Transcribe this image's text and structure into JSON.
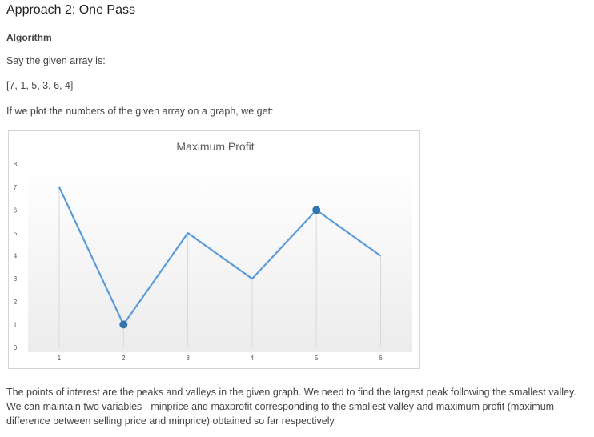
{
  "heading": "Approach 2: One Pass",
  "subheading": "Algorithm",
  "intro": "Say the given array is:",
  "array_text": "[7, 1, 5, 3, 6, 4]",
  "plot_text": "If we plot the numbers of the given array on a graph, we get:",
  "chart_data": {
    "type": "line",
    "title": "Maximum Profit",
    "x": [
      1,
      2,
      3,
      4,
      5,
      6
    ],
    "y": [
      7,
      1,
      5,
      3,
      6,
      4
    ],
    "xlabel": "",
    "ylabel": "",
    "ylim": [
      0,
      8
    ],
    "yticks": [
      0,
      1,
      2,
      3,
      4,
      5,
      6,
      7,
      8
    ],
    "grid": "vertical drop lines at each x",
    "highlighted_points": [
      {
        "x": 2,
        "y": 1
      },
      {
        "x": 5,
        "y": 6
      }
    ],
    "line_color": "#5b9bd5",
    "marker_color": "#2e75b6"
  },
  "explanation": "The points of interest are the peaks and valleys in the given graph. We need to find the largest peak following the smallest valley. We can maintain two variables - minprice and maxprofit corresponding to the smallest valley and maximum profit (maximum difference between selling price and minprice) obtained so far respectively."
}
